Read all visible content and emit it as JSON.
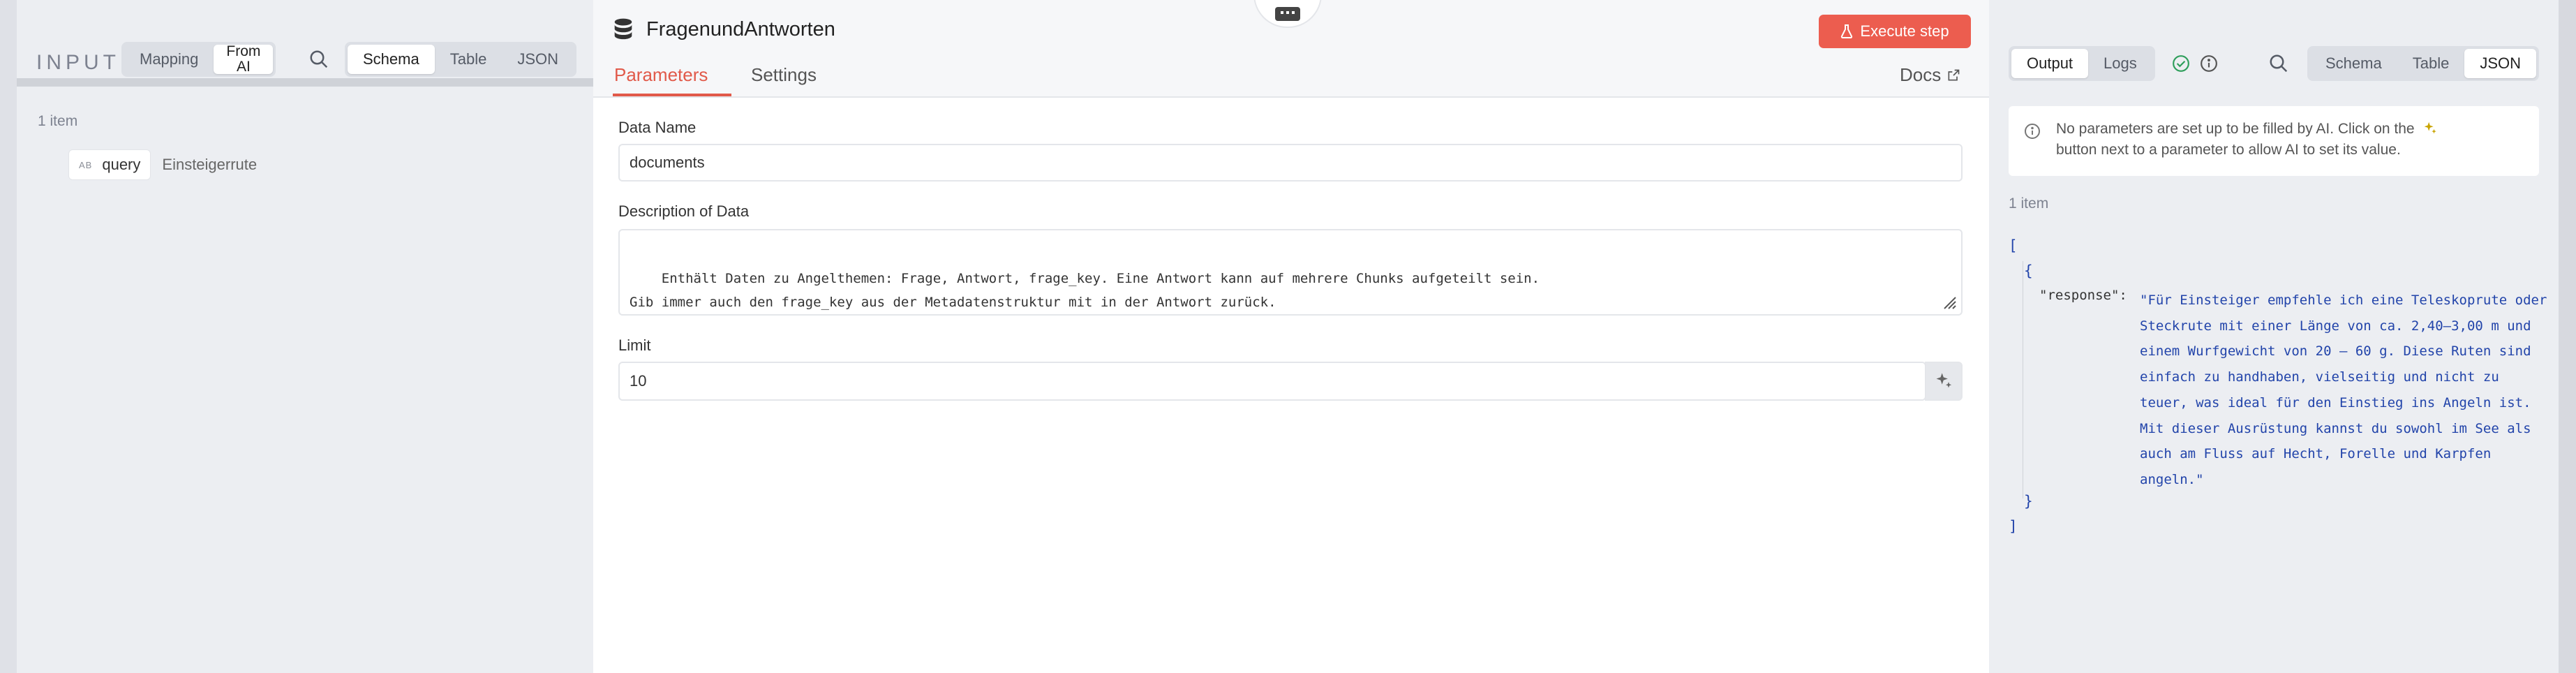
{
  "input_panel": {
    "title": "INPUT",
    "mode_tabs": [
      {
        "label": "Mapping"
      },
      {
        "label_line1": "From",
        "label_line2": "AI"
      }
    ],
    "view_tabs": [
      {
        "label": "Schema"
      },
      {
        "label": "Table"
      },
      {
        "label": "JSON"
      }
    ],
    "item_count": "1 item",
    "field": {
      "type": "AB",
      "name": "query",
      "value": "Einsteigerrute"
    }
  },
  "node": {
    "title": "FragenundAntworten",
    "execute_label": "Execute step",
    "tabs": [
      {
        "label": "Parameters"
      },
      {
        "label": "Settings"
      }
    ],
    "docs_label": "Docs",
    "params": {
      "data_name_label": "Data Name",
      "data_name_value": "documents",
      "description_label": "Description of Data",
      "description_value": "Enthält Daten zu Angelthemen: Frage, Antwort, frage_key. Eine Antwort kann auf mehrere Chunks aufgeteilt sein.\nGib immer auch den frage_key aus der Metadatenstruktur mit in der Antwort zurück.",
      "limit_label": "Limit",
      "limit_value": "10"
    }
  },
  "output_panel": {
    "tabs": [
      {
        "label": "Output"
      },
      {
        "label": "Logs"
      }
    ],
    "view_tabs": [
      {
        "label": "Schema"
      },
      {
        "label": "Table"
      },
      {
        "label": "JSON"
      }
    ],
    "notice_line1": "No parameters are set up to be filled by AI. Click on the",
    "notice_line2": "button next to a parameter to allow AI to set its value.",
    "item_count": "1 item",
    "json": {
      "open_bracket": "[",
      "open_brace": "{",
      "key": "\"response\":",
      "value": "\"Für Einsteiger empfehle ich eine Teleskoprute oder Steckrute mit einer Länge von ca. 2,40–3,00 m und einem Wurfgewicht von 20 – 60 g. Diese Ruten sind einfach zu handhaben, vielseitig und nicht zu teuer, was ideal für den Einstieg ins Angeln ist. Mit dieser Ausrüstung kannst du sowohl im See als auch am Fluss auf Hecht, Forelle und Karpfen angeln.\"",
      "close_brace": "}",
      "close_bracket": "]"
    }
  },
  "colors": {
    "accent": "#ec5d4f",
    "json_value": "#2244aa",
    "success": "#2e9e5b"
  }
}
